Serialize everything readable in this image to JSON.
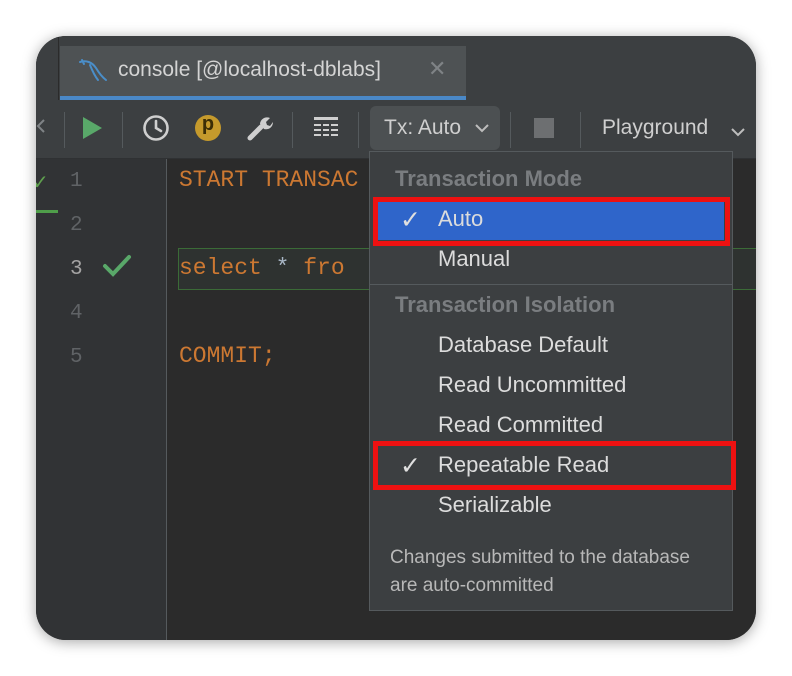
{
  "tab": {
    "label": "console [@localhost-dblabs]",
    "close": "✕",
    "icon": "mysql-dolphin-icon"
  },
  "toolbar": {
    "tx_label": "Tx: Auto",
    "session_label": "Playground",
    "icons": [
      "run-icon",
      "history-icon",
      "pin-parameters-icon",
      "settings-wrench-icon",
      "output-table-icon",
      "stop-icon"
    ],
    "pin_letter": "p"
  },
  "editor": {
    "line_numbers": [
      "1",
      "2",
      "3",
      "4",
      "5"
    ],
    "active_line": "3",
    "lines": {
      "1": "START TRANSAC",
      "3_keyword1": "select",
      "3_op": " * ",
      "3_keyword2": "fro",
      "5": "COMMIT;"
    }
  },
  "dropdown": {
    "mode_title": "Transaction Mode",
    "modes": [
      {
        "label": "Auto",
        "checked": true
      },
      {
        "label": "Manual",
        "checked": false
      }
    ],
    "isolation_title": "Transaction Isolation",
    "isolations": [
      {
        "label": "Database Default",
        "checked": false
      },
      {
        "label": "Read Uncommitted",
        "checked": false
      },
      {
        "label": "Read Committed",
        "checked": false
      },
      {
        "label": "Repeatable Read",
        "checked": true
      },
      {
        "label": "Serializable",
        "checked": false
      }
    ],
    "check_glyph": "✓",
    "hint": "Changes submitted to the database are auto-committed"
  },
  "colors": {
    "accent": "#2f65ca",
    "highlight": "#ee1111",
    "keyword": "#cc7832",
    "run_green": "#59a869"
  }
}
